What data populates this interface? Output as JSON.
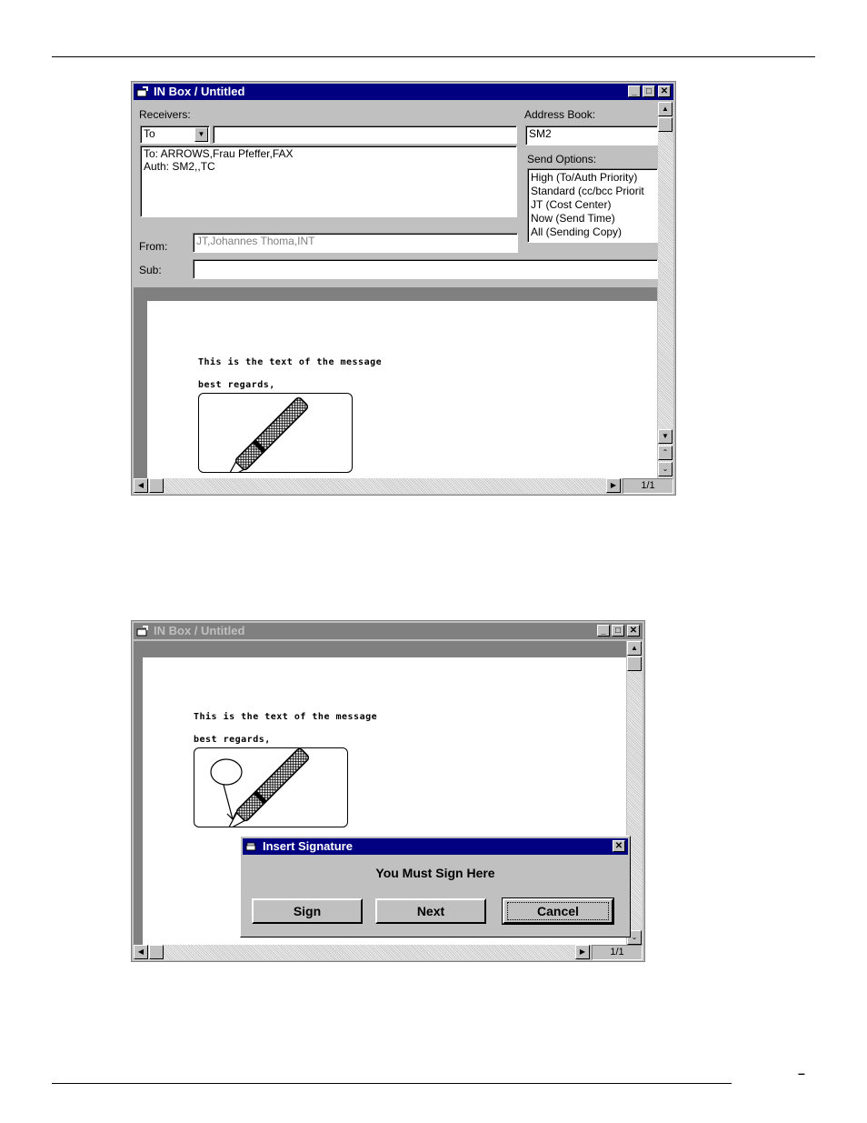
{
  "window1": {
    "title": "IN Box / Untitled",
    "receivers_label": "Receivers:",
    "receiver_type": "To",
    "receiver_input": "",
    "receivers_list": [
      "To: ARROWS,Frau Pfeffer,FAX",
      "Auth: SM2,,TC"
    ],
    "address_book_label": "Address Book:",
    "address_book_value": "SM2",
    "send_options_label": "Send Options:",
    "send_options": [
      "High  (To/Auth Priority)",
      "Standard  (cc/bcc Priorit",
      "JT  (Cost Center)",
      "Now  (Send Time)",
      "All  (Sending Copy)"
    ],
    "from_label": "From:",
    "from_value": "JT,Johannes Thoma,INT",
    "sub_label": "Sub:",
    "sub_value": "",
    "message_line1": "This is the text of the message",
    "message_line2": "best regards,",
    "page_indicator": "1/1"
  },
  "window2": {
    "title": "IN Box / Untitled",
    "message_line1": "This is the text of the message",
    "message_line2": "best regards,",
    "page_indicator": "1/1"
  },
  "dialog": {
    "title": "Insert Signature",
    "message": "You Must Sign Here",
    "sign_label": "Sign",
    "next_label": "Next",
    "cancel_label": "Cancel"
  },
  "footer": {
    "mark": "–"
  },
  "colors": {
    "title_active": "#000080",
    "title_inactive": "#808080",
    "face": "#c0c0c0"
  }
}
